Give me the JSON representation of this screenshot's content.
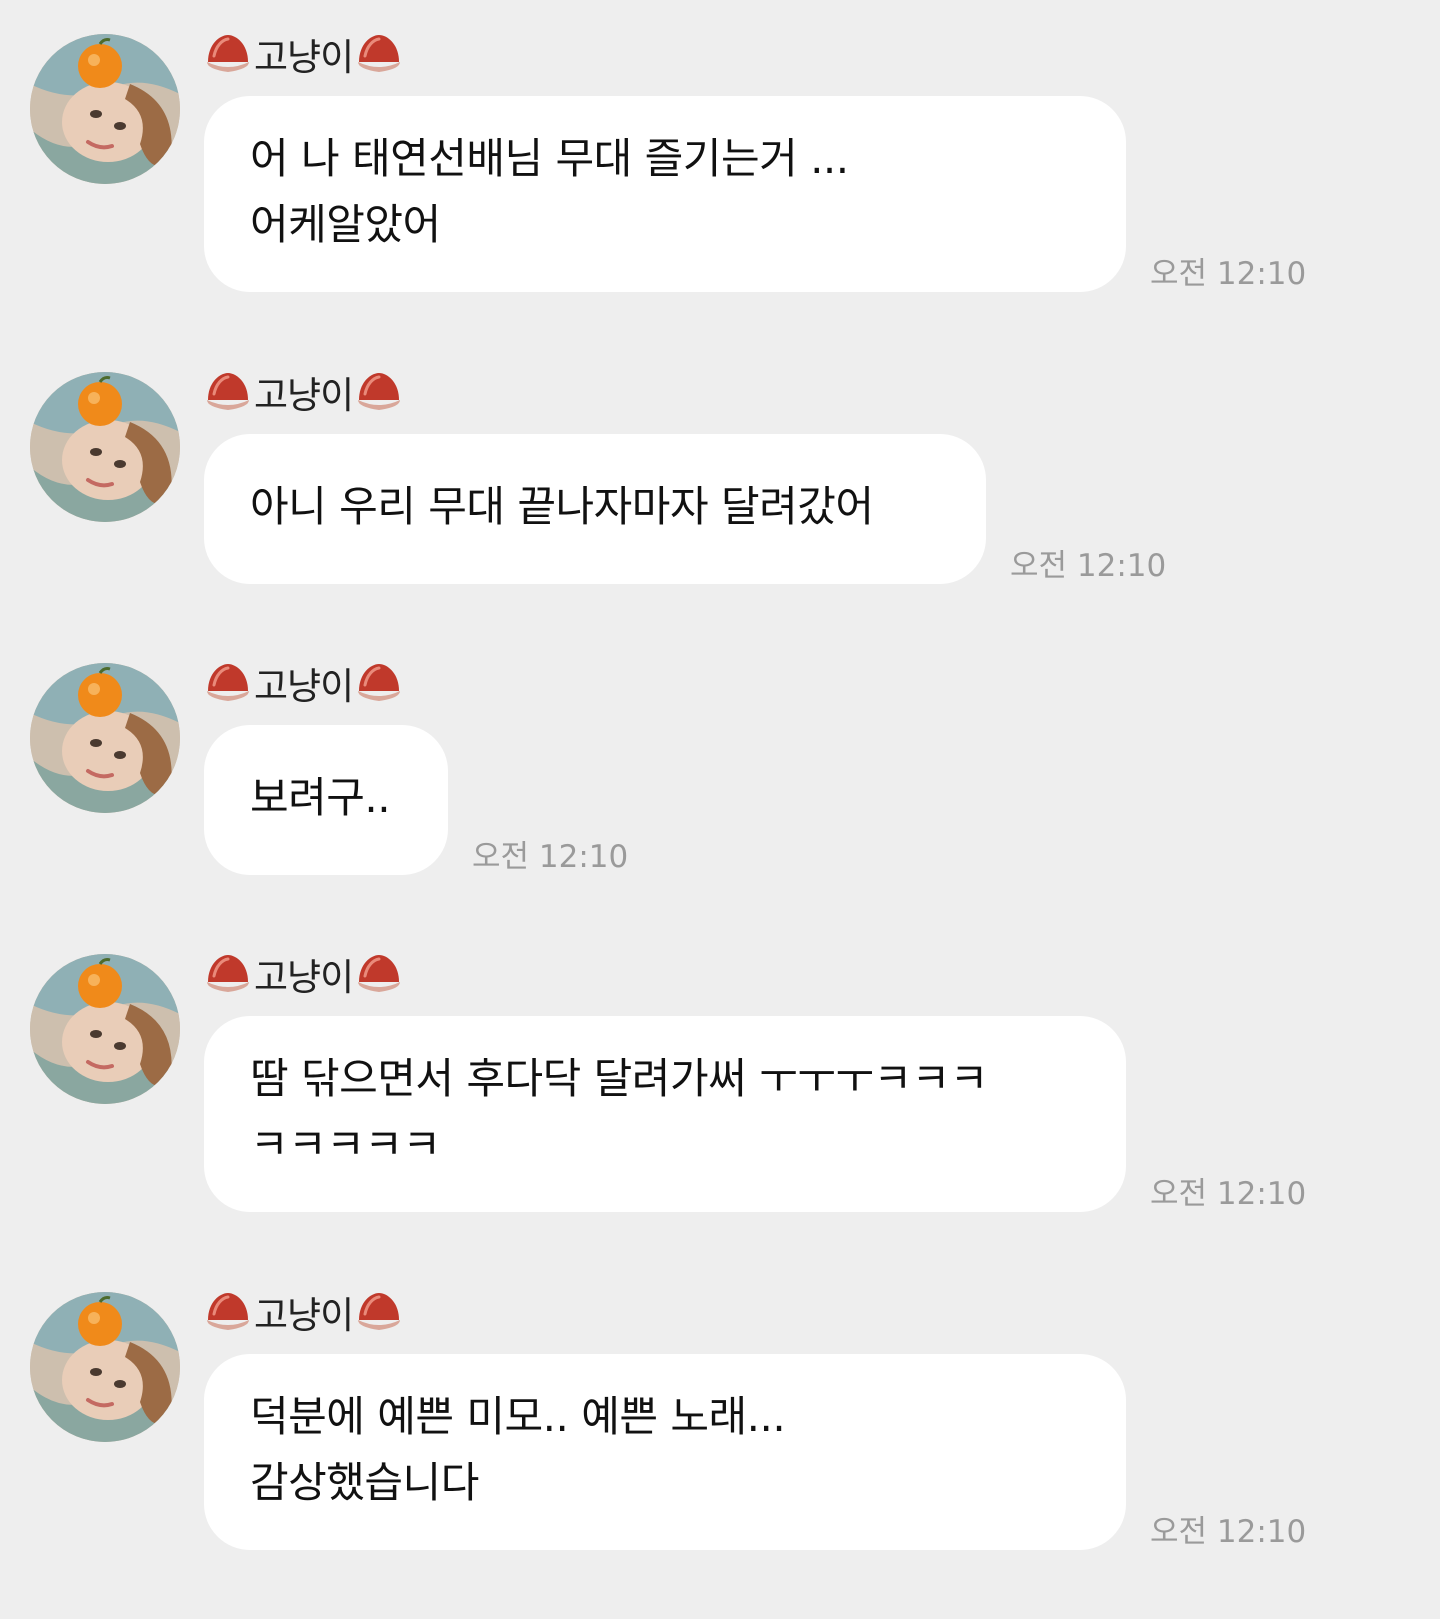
{
  "colors": {
    "background": "#eeeeee",
    "bubble": "#ffffff",
    "text": "#111111",
    "timestamp": "#9a9a9a",
    "chestnut": "#c0392b"
  },
  "icons": {
    "sender_decoration": "chestnut-icon",
    "avatar": "profile-avatar"
  },
  "messages": [
    {
      "sender": "고냥이",
      "text": "어 나 태연선배님 무대 즐기는거 ...\n어케알았어",
      "time": "오전 12:10"
    },
    {
      "sender": "고냥이",
      "text": "아니 우리 무대 끝나자마자 달려갔어",
      "time": "오전 12:10"
    },
    {
      "sender": "고냥이",
      "text": "보려구..",
      "time": "오전 12:10"
    },
    {
      "sender": "고냥이",
      "text": "땀 닦으면서 후다닥 달려가써 ㅜㅜㅜㅋㅋㅋ\nㅋㅋㅋㅋㅋ",
      "time": "오전 12:10"
    },
    {
      "sender": "고냥이",
      "text": "덕분에 예쁜 미모.. 예쁜 노래...\n감상했습니다",
      "time": "오전 12:10"
    }
  ]
}
